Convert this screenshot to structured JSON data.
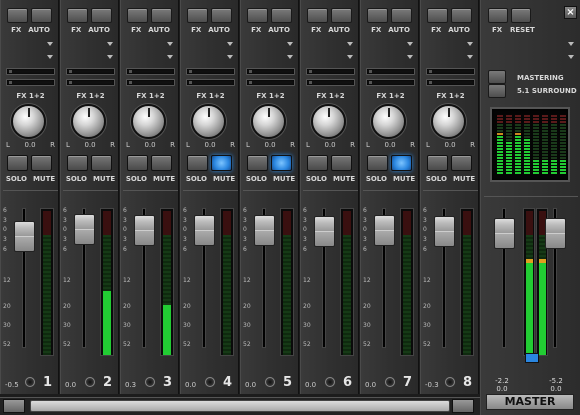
{
  "window": {
    "close_label": "×"
  },
  "labels": {
    "fx": "FX",
    "auto": "AUTO",
    "fx12": "FX 1+2",
    "solo": "SOLO",
    "mute": "MUTE",
    "l": "L",
    "r": "R",
    "pan": "0.0"
  },
  "scale": [
    "6",
    "3",
    "0",
    "3",
    "6",
    "12",
    "20",
    "30",
    "52"
  ],
  "channels": [
    {
      "number": "1",
      "gain": "-0.5",
      "solo_on": false
    },
    {
      "number": "2",
      "gain": "0.0",
      "solo_on": false
    },
    {
      "number": "3",
      "gain": "0.3",
      "solo_on": false
    },
    {
      "number": "4",
      "gain": "0.0",
      "solo_on": true
    },
    {
      "number": "5",
      "gain": "0.0",
      "solo_on": true
    },
    {
      "number": "6",
      "gain": "0.0",
      "solo_on": false
    },
    {
      "number": "7",
      "gain": "0.0",
      "solo_on": true
    },
    {
      "number": "8",
      "gain": "-0.3",
      "solo_on": false
    }
  ],
  "master": {
    "fx": "FX",
    "reset": "RESET",
    "mastering": "MASTERING",
    "surround": "5.1 SURROUND",
    "left_level": "-2.2",
    "left_gain": "0.0",
    "right_level": "-5.2",
    "right_gain": "0.0",
    "tag": "MASTER"
  },
  "colors": {
    "solo_active": "#2a86e0",
    "meter_green": "#22cc33",
    "meter_red": "#e03030",
    "meter_amber": "#e0a020"
  }
}
